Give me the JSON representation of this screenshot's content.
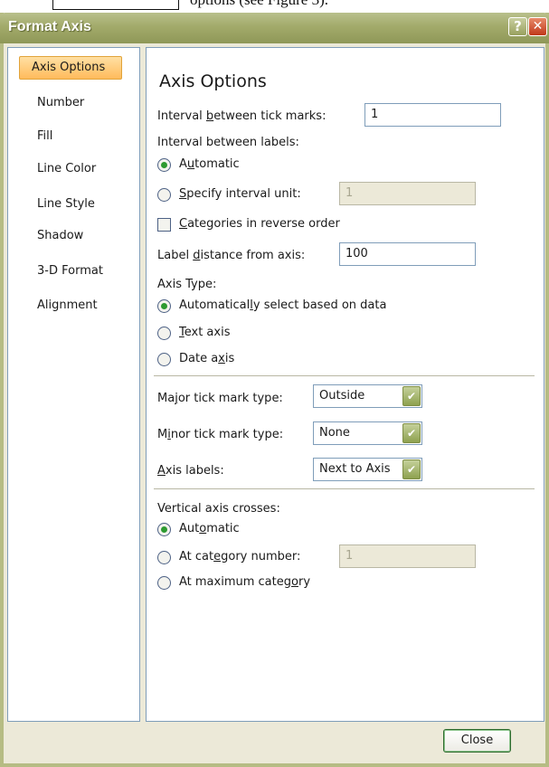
{
  "doc_fragment": {
    "text": "options (see Figure 3)."
  },
  "window": {
    "title": "Format Axis",
    "help_label": "?",
    "close_label": "✕"
  },
  "nav": {
    "items": [
      {
        "label": "Axis Options",
        "active": true
      },
      {
        "label": "Number"
      },
      {
        "label": "Fill"
      },
      {
        "label": "Line Color"
      },
      {
        "label": "Line Style"
      },
      {
        "label": "Shadow"
      },
      {
        "label": "3-D Format"
      },
      {
        "label": "Alignment"
      }
    ]
  },
  "panel": {
    "heading": "Axis Options",
    "interval_ticks": {
      "pre": "Interval ",
      "ul": "b",
      "post": "etween tick marks:",
      "value": "1"
    },
    "interval_labels": {
      "label": "Interval between labels:",
      "automatic": {
        "pre": "A",
        "ul": "u",
        "post": "tomatic",
        "selected": true
      },
      "specify": {
        "pre": "",
        "ul": "S",
        "post": "pecify interval unit:",
        "value": "1",
        "selected": false
      }
    },
    "reverse_order": {
      "pre": "",
      "ul": "C",
      "post": "ategories in reverse order",
      "checked": false
    },
    "label_distance": {
      "pre": "Label ",
      "ul": "d",
      "post": "istance from axis:",
      "value": "100"
    },
    "axis_type": {
      "label": "Axis Type:",
      "auto": {
        "pre": "Automatical",
        "ul": "l",
        "post": "y select based on data",
        "selected": true
      },
      "text": {
        "pre": "",
        "ul": "T",
        "post": "ext axis",
        "selected": false
      },
      "date": {
        "pre": "Date a",
        "ul": "x",
        "post": "is",
        "selected": false
      }
    },
    "major_tick": {
      "pre": "Ma",
      "ul": "j",
      "post": "or tick mark type:",
      "value": "Outside"
    },
    "minor_tick": {
      "pre": "M",
      "ul": "i",
      "post": "nor tick mark type:",
      "value": "None"
    },
    "axis_labels": {
      "pre": "",
      "ul": "A",
      "post": "xis labels:",
      "value": "Next to Axis"
    },
    "vertical_crosses": {
      "label": "Vertical axis crosses:",
      "automatic": {
        "pre": "Aut",
        "ul": "o",
        "post": "matic",
        "selected": true
      },
      "category_number": {
        "pre": "At cat",
        "ul": "e",
        "post": "gory number:",
        "value": "1",
        "selected": false
      },
      "max_category": {
        "pre": "At maximum categ",
        "ul": "o",
        "post": "ry",
        "selected": false
      }
    }
  },
  "footer": {
    "close_label": "Close"
  },
  "icons": {
    "dropdown": "chevron-down-icon",
    "radio": "radio-icon",
    "checkbox": "checkbox-icon"
  },
  "colors": {
    "title_bar": "#a2aa6a",
    "nav_active": "#ffbb5c",
    "dialog_bg": "#ece9d8"
  }
}
